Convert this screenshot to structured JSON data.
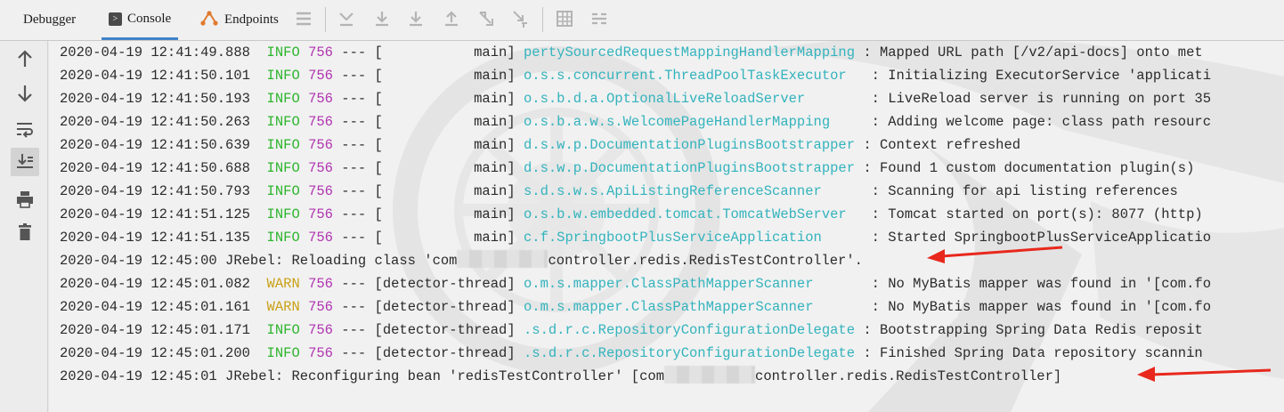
{
  "tabs": [
    {
      "label": "Debugger",
      "icon": "none"
    },
    {
      "label": "Console",
      "icon": "console-icon",
      "active": true
    },
    {
      "label": "Endpoints",
      "icon": "endpoints-icon"
    }
  ],
  "toolbar_icons": [
    "menu-lines-icon",
    "show-execution-point-icon",
    "step-over-icon",
    "step-into-icon",
    "force-step-into-icon",
    "step-out-icon",
    "drop-frame-icon",
    "run-to-cursor-icon",
    "evaluate-expression-icon",
    "trace-current-stream-icon"
  ],
  "sidebar_icons": [
    "arrow-up-icon",
    "arrow-down-icon",
    "soft-wrap-icon",
    "scroll-to-end-icon",
    "print-icon",
    "trash-icon"
  ],
  "colors": {
    "info": "#2db52d",
    "warn": "#c9a116",
    "pid": "#b033b0",
    "logger": "#33b3bd",
    "text": "#2b2b2b",
    "arrow": "#e8281c",
    "tab_accent": "#4083c9"
  },
  "log": {
    "lines": [
      {
        "kind": "log",
        "ts": "2020-04-19 12:41:49.888",
        "level": "INFO",
        "pid": "756",
        "sep": "---",
        "thread": "[           main]",
        "logger": "pertySourcedRequestMappingHandlerMapping",
        "msg": ": Mapped URL path [/v2/api-docs] onto met"
      },
      {
        "kind": "log",
        "ts": "2020-04-19 12:41:50.101",
        "level": "INFO",
        "pid": "756",
        "sep": "---",
        "thread": "[           main]",
        "logger": "o.s.s.concurrent.ThreadPoolTaskExecutor  ",
        "msg": ": Initializing ExecutorService 'applicati"
      },
      {
        "kind": "log",
        "ts": "2020-04-19 12:41:50.193",
        "level": "INFO",
        "pid": "756",
        "sep": "---",
        "thread": "[           main]",
        "logger": "o.s.b.d.a.OptionalLiveReloadServer       ",
        "msg": ": LiveReload server is running on port 35"
      },
      {
        "kind": "log",
        "ts": "2020-04-19 12:41:50.263",
        "level": "INFO",
        "pid": "756",
        "sep": "---",
        "thread": "[           main]",
        "logger": "o.s.b.a.w.s.WelcomePageHandlerMapping    ",
        "msg": ": Adding welcome page: class path resourc"
      },
      {
        "kind": "log",
        "ts": "2020-04-19 12:41:50.639",
        "level": "INFO",
        "pid": "756",
        "sep": "---",
        "thread": "[           main]",
        "logger": "d.s.w.p.DocumentationPluginsBootstrapper",
        "msg": ": Context refreshed"
      },
      {
        "kind": "log",
        "ts": "2020-04-19 12:41:50.688",
        "level": "INFO",
        "pid": "756",
        "sep": "---",
        "thread": "[           main]",
        "logger": "d.s.w.p.DocumentationPluginsBootstrapper",
        "msg": ": Found 1 custom documentation plugin(s)"
      },
      {
        "kind": "log",
        "ts": "2020-04-19 12:41:50.793",
        "level": "INFO",
        "pid": "756",
        "sep": "---",
        "thread": "[           main]",
        "logger": "s.d.s.w.s.ApiListingReferenceScanner     ",
        "msg": ": Scanning for api listing references"
      },
      {
        "kind": "log",
        "ts": "2020-04-19 12:41:51.125",
        "level": "INFO",
        "pid": "756",
        "sep": "---",
        "thread": "[           main]",
        "logger": "o.s.b.w.embedded.tomcat.TomcatWebServer  ",
        "msg": ": Tomcat started on port(s): 8077 (http)"
      },
      {
        "kind": "log",
        "ts": "2020-04-19 12:41:51.135",
        "level": "INFO",
        "pid": "756",
        "sep": "---",
        "thread": "[           main]",
        "logger": "c.f.SpringbootPlusServiceApplication     ",
        "msg": ": Started SpringbootPlusServiceApplicatio"
      },
      {
        "kind": "plain",
        "pre": "2020-04-19 12:45:00 JRebel: Reloading class 'com",
        "post": "controller.redis.RedisTestController'."
      },
      {
        "kind": "log",
        "ts": "2020-04-19 12:45:01.082",
        "level": "WARN",
        "pid": "756",
        "sep": "---",
        "thread": "[detector-thread]",
        "logger": "o.m.s.mapper.ClassPathMapperScanner      ",
        "msg": ": No MyBatis mapper was found in '[com.fo"
      },
      {
        "kind": "log",
        "ts": "2020-04-19 12:45:01.161",
        "level": "WARN",
        "pid": "756",
        "sep": "---",
        "thread": "[detector-thread]",
        "logger": "o.m.s.mapper.ClassPathMapperScanner      ",
        "msg": ": No MyBatis mapper was found in '[com.fo"
      },
      {
        "kind": "log",
        "ts": "2020-04-19 12:45:01.171",
        "level": "INFO",
        "pid": "756",
        "sep": "---",
        "thread": "[detector-thread]",
        "logger": ".s.d.r.c.RepositoryConfigurationDelegate",
        "msg": ": Bootstrapping Spring Data Redis reposit"
      },
      {
        "kind": "log",
        "ts": "2020-04-19 12:45:01.200",
        "level": "INFO",
        "pid": "756",
        "sep": "---",
        "thread": "[detector-thread]",
        "logger": ".s.d.r.c.RepositoryConfigurationDelegate",
        "msg": ": Finished Spring Data repository scannin"
      },
      {
        "kind": "plain",
        "pre": "2020-04-19 12:45:01 JRebel: Reconfiguring bean 'redisTestController' [com",
        "post": "controller.redis.RedisTestController]"
      }
    ]
  }
}
